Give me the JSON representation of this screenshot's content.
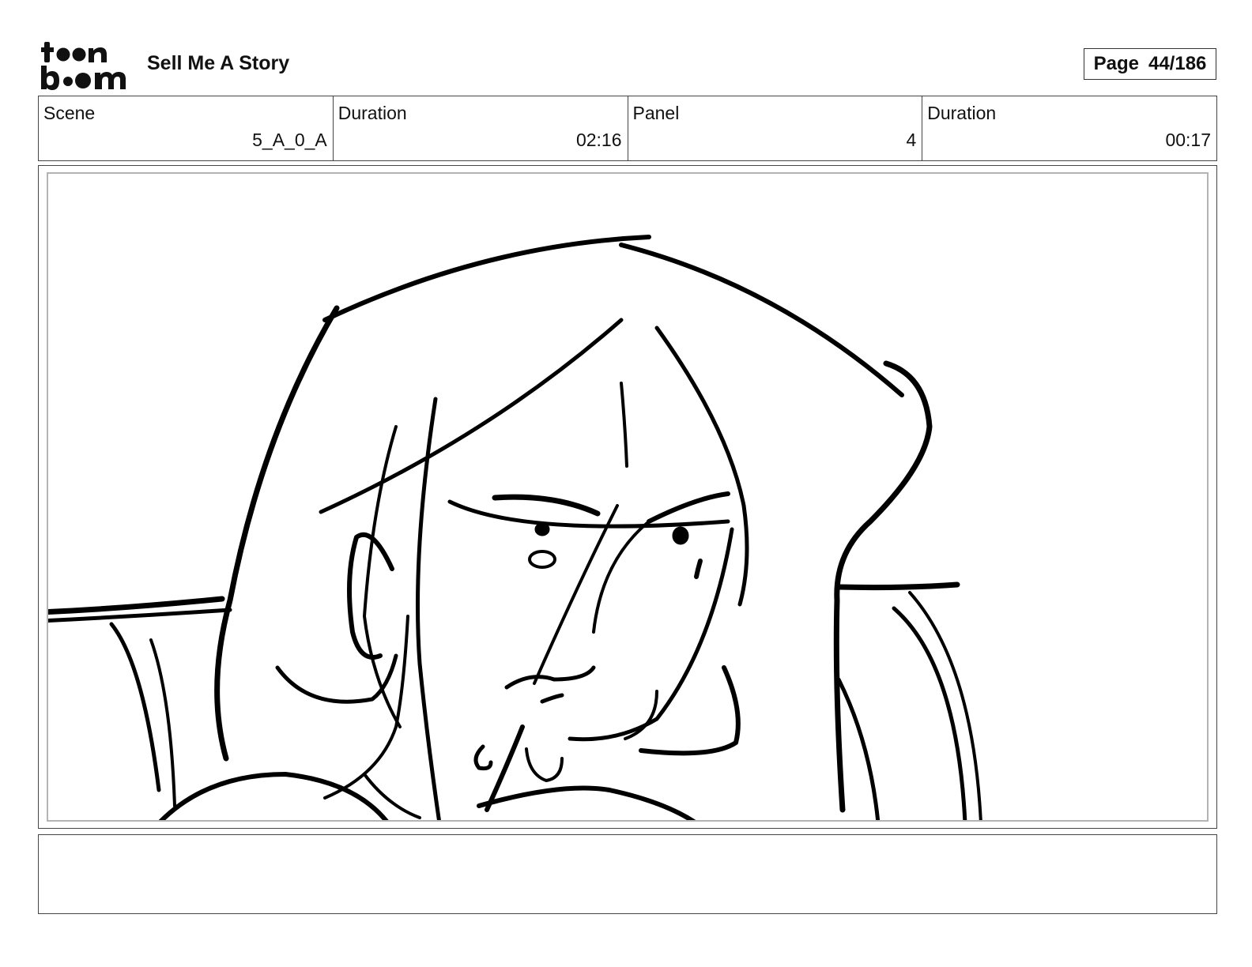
{
  "header": {
    "logo": {
      "name": "toon-boom-logo",
      "text_line1": "toon",
      "text_line2": "boom"
    },
    "project_title": "Sell Me A Story",
    "page": {
      "label": "Page",
      "value": "44/186"
    }
  },
  "info": [
    {
      "label": "Scene",
      "value": "5_A_0_A"
    },
    {
      "label": "Duration",
      "value": "02:16"
    },
    {
      "label": "Panel",
      "value": "4"
    },
    {
      "label": "Duration",
      "value": "00:17"
    }
  ],
  "panel": {
    "image": "storyboard-sketch-woman-close-up"
  },
  "notes": {
    "text": ""
  },
  "colors": {
    "ink": "#000000",
    "frame": "#444444",
    "inner_frame": "#b4b4b4",
    "background": "#ffffff"
  }
}
